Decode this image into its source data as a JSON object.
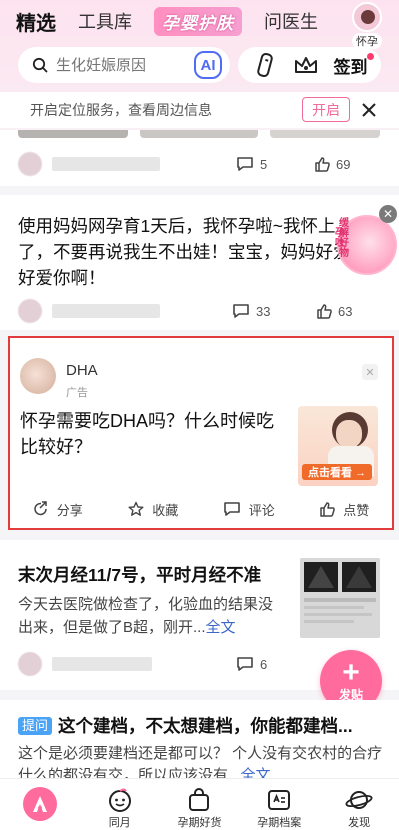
{
  "header": {
    "tabs": [
      {
        "label": "精选",
        "active": true
      },
      {
        "label": "工具库",
        "active": false
      },
      {
        "label": "孕婴护肤",
        "active": false
      },
      {
        "label": "问医生",
        "active": false
      }
    ],
    "avatar_label": "怀孕",
    "search_placeholder": "生化妊娠原因",
    "ai_label": "AI",
    "checkin_label": "签到"
  },
  "location_bar": {
    "text": "开启定位服务，查看周边信息",
    "open_label": "开启"
  },
  "post1": {
    "comments": "5",
    "likes": "69"
  },
  "post2": {
    "text": "使用妈妈网孕育1天后，我怀孕啦~我怀上了，不要再说我生不出娃！宝宝，妈妈好爱好爱你啊！",
    "comments": "33",
    "likes": "63"
  },
  "float_ad": {
    "text": "缓解好物",
    "side_text": "孕吐"
  },
  "ad": {
    "name": "DHA",
    "tag": "广告",
    "title": "怀孕需要吃DHA吗？什么时候吃比较好？",
    "image_cta": "点击看看 →",
    "actions": [
      "分享",
      "收藏",
      "评论",
      "点赞"
    ]
  },
  "post4": {
    "title": "末次月经11/7号，平时月经不准",
    "body": "今天去医院做检查了，化验血的结果没出来，但是做了B超，刚开...",
    "more": "全文",
    "comments": "6"
  },
  "fab": {
    "label": "发贴"
  },
  "post5": {
    "tag": "提问",
    "title": "这个建档，不太想建档，你能都建档...",
    "body": "这个是必须要建档还是都可以？ 个人没有交农村的合疗什么的都没有交，所以应该没有...",
    "more": "全文"
  },
  "bottom_nav": [
    {
      "label": ""
    },
    {
      "label": "同月"
    },
    {
      "label": "孕期好货"
    },
    {
      "label": "孕期档案"
    },
    {
      "label": "发现"
    }
  ]
}
